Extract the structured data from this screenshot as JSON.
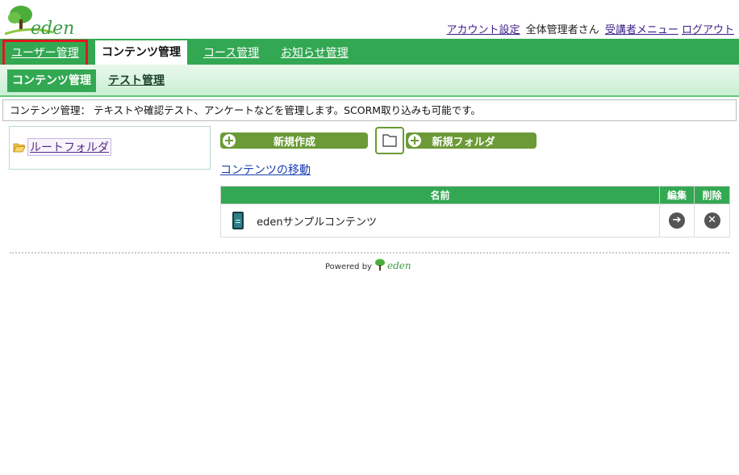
{
  "header": {
    "logo_text": "eden",
    "account_settings": "アカウント設定",
    "user_name": "全体管理者さん",
    "learner_menu": "受講者メニュー",
    "logout": "ログアウト"
  },
  "main_nav": {
    "tabs": [
      {
        "label": "ユーザー管理"
      },
      {
        "label": "コンテンツ管理"
      },
      {
        "label": "コース管理"
      },
      {
        "label": "お知らせ管理"
      }
    ]
  },
  "sub_nav": {
    "tabs": [
      {
        "label": "コンテンツ管理"
      },
      {
        "label": "テスト管理"
      }
    ]
  },
  "description": "コンテンツ管理： テキストや確認テスト、アンケートなどを管理します。SCORM取り込みも可能です。",
  "tree": {
    "root_label": "ルートフォルダ"
  },
  "actions": {
    "new_create": "新規作成",
    "new_folder": "新規フォルダ",
    "move_contents": "コンテンツの移動"
  },
  "table": {
    "headers": {
      "name": "名前",
      "edit": "編集",
      "delete": "削除"
    },
    "rows": [
      {
        "name": "edenサンプルコンテンツ"
      }
    ]
  },
  "footer": {
    "powered_by": "Powered by",
    "brand": "eden"
  },
  "colors": {
    "primary_green": "#33a852",
    "button_green": "#6b9a36",
    "highlight_red": "#e3161e"
  }
}
